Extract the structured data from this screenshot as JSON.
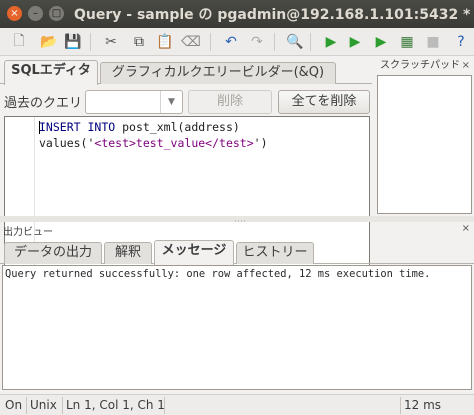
{
  "window": {
    "title": "Query - sample の pgadmin@192.168.1.101:5432 *",
    "controls": {
      "close": "×",
      "minimize": "–",
      "maximize": "□"
    }
  },
  "toolbar": {
    "icons": [
      {
        "name": "new-document-icon",
        "glyph": "🗋",
        "color": "#777"
      },
      {
        "name": "open-folder-icon",
        "glyph": "📂",
        "color": "#c98a1a"
      },
      {
        "name": "save-icon",
        "glyph": "💾",
        "color": "#2e5fa8"
      },
      {
        "name": "cut-icon",
        "glyph": "✂",
        "color": "#555"
      },
      {
        "name": "copy-icon",
        "glyph": "⧉",
        "color": "#444"
      },
      {
        "name": "paste-icon",
        "glyph": "📋",
        "color": "#8a6a2a"
      },
      {
        "name": "clear-icon",
        "glyph": "⌫",
        "color": "#888"
      },
      {
        "name": "undo-icon",
        "glyph": "↶",
        "color": "#2d64b3"
      },
      {
        "name": "redo-icon",
        "glyph": "↷",
        "color": "#aaa"
      },
      {
        "name": "find-icon",
        "glyph": "🔍",
        "color": "#555"
      },
      {
        "name": "execute-icon",
        "glyph": "▶",
        "color": "#2e9e2e"
      },
      {
        "name": "execute-pgscript-icon",
        "glyph": "▶",
        "color": "#2e9e2e"
      },
      {
        "name": "execute-to-file-icon",
        "glyph": "▶",
        "color": "#2e9e2e"
      },
      {
        "name": "explain-icon",
        "glyph": "▦",
        "color": "#3a7a3a"
      },
      {
        "name": "cancel-query-icon",
        "glyph": "■",
        "color": "#bbb"
      },
      {
        "name": "help-icon",
        "glyph": "?",
        "color": "#1f5fb5"
      }
    ]
  },
  "editor_tabs": [
    {
      "label": "SQLエディタ",
      "active": true
    },
    {
      "label": "グラフィカルクエリービルダー(&Q)",
      "active": false
    }
  ],
  "history": {
    "label": "過去のクエリ",
    "combo_value": "",
    "delete_label": "削除",
    "delete_all_label": "全てを削除"
  },
  "sql": {
    "line1_kw1": "INSERT",
    "line1_kw2": "INTO",
    "line1_rest": " post_xml(address)",
    "line2_func": "values('",
    "line2_str": "<test>test_value</test>",
    "line2_end": "')"
  },
  "scratchpad": {
    "title": "スクラッチパッド",
    "close": "×"
  },
  "output": {
    "title": "出力ビュー",
    "close": "×",
    "tabs": [
      {
        "label": "データの出力",
        "active": false
      },
      {
        "label": "解釈",
        "active": false
      },
      {
        "label": "メッセージ",
        "active": true
      },
      {
        "label": "ヒストリー",
        "active": false
      }
    ],
    "message": "Query returned successfully: one row affected, 12 ms execution time."
  },
  "status": {
    "mode": "On",
    "eol": "Unix",
    "position": "Ln 1, Col 1, Ch 1",
    "blank": "",
    "time": "12 ms"
  }
}
